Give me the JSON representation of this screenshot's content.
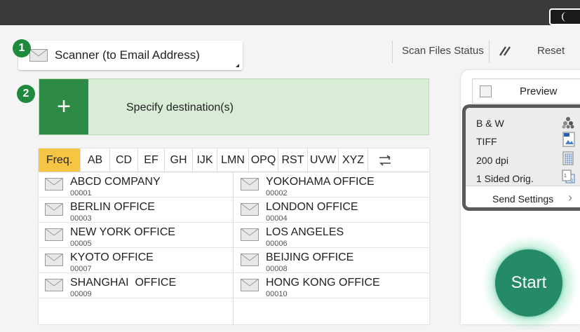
{
  "function": {
    "label": "Scanner (to Email Address)",
    "badge": "1"
  },
  "header": {
    "scan_files_status": "Scan Files Status",
    "reset": "Reset"
  },
  "destination": {
    "badge": "2",
    "plus": "+",
    "label": "Specify destination(s)"
  },
  "tabs": [
    {
      "label": "Freq.",
      "active": true
    },
    {
      "label": "AB"
    },
    {
      "label": "CD"
    },
    {
      "label": "EF"
    },
    {
      "label": "GH"
    },
    {
      "label": "IJK"
    },
    {
      "label": "LMN"
    },
    {
      "label": "OPQ"
    },
    {
      "label": "RST"
    },
    {
      "label": "UVW"
    },
    {
      "label": "XYZ"
    }
  ],
  "entries": [
    {
      "name": "ABCD COMPANY",
      "number": "00001"
    },
    {
      "name": "YOKOHAMA OFFICE",
      "number": "00002"
    },
    {
      "name": "BERLIN OFFICE",
      "number": "00003"
    },
    {
      "name": "LONDON OFFICE",
      "number": "00004"
    },
    {
      "name": "NEW YORK OFFICE",
      "number": "00005"
    },
    {
      "name": "LOS ANGELES",
      "number": "00006"
    },
    {
      "name": "KYOTO OFFICE",
      "number": "00007"
    },
    {
      "name": "BEIJING OFFICE",
      "number": "00008"
    },
    {
      "name": "SHANGHAI  OFFICE",
      "number": "00009"
    },
    {
      "name": "HONG KONG OFFICE",
      "number": "00010"
    }
  ],
  "preview": {
    "label": "Preview",
    "checked": false
  },
  "settings": {
    "color": "B & W",
    "file_type": "TIFF",
    "resolution": "200 dpi",
    "original": "1 Sided Orig.",
    "send_settings": "Send Settings"
  },
  "start": {
    "label": "Start"
  },
  "colors": {
    "accent_green": "#2e8b45",
    "start_green": "#258a67",
    "tab_active": "#f6c544"
  }
}
